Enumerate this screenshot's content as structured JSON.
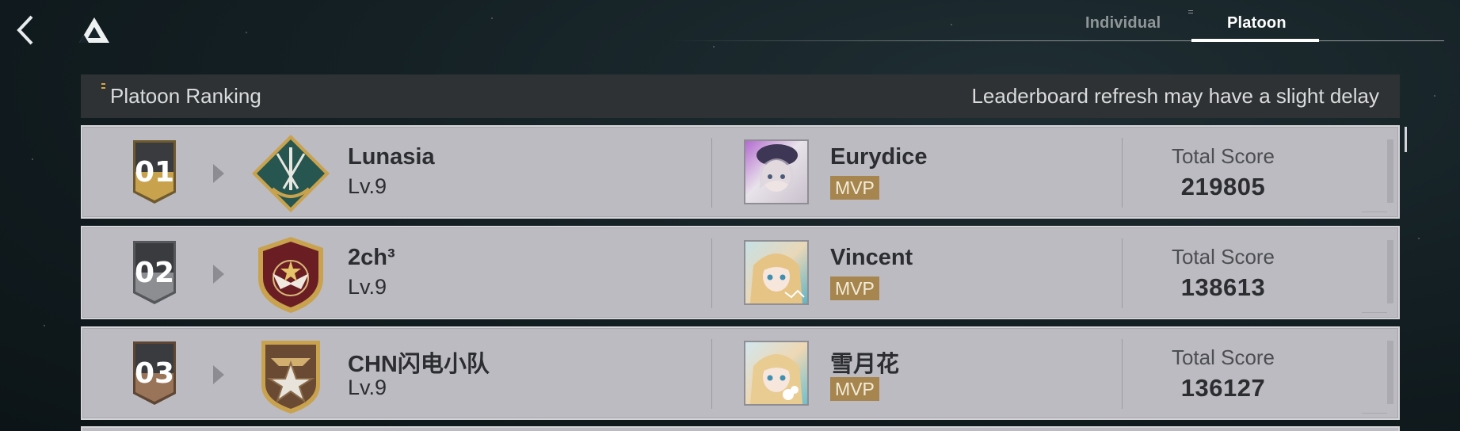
{
  "header": {
    "tabs": [
      {
        "label": "Individual",
        "active": false
      },
      {
        "label": "Platoon",
        "active": true
      }
    ]
  },
  "section": {
    "title": "Platoon Ranking",
    "note": "Leaderboard refresh may have a slight delay"
  },
  "rows": [
    {
      "rank": "01",
      "rank_color": "#c9a24e",
      "platoon_name": "Lunasia",
      "level": "Lv.9",
      "mvp_name": "Eurydice",
      "mvp_badge": "MVP",
      "score_label": "Total Score",
      "score": "219805",
      "emblem": "swords-shield-emblem-icon"
    },
    {
      "rank": "02",
      "rank_color": "#8c8e92",
      "platoon_name": "2ch³",
      "level": "Lv.9",
      "mvp_name": "Vincent",
      "mvp_badge": "MVP",
      "score_label": "Total Score",
      "score": "138613",
      "emblem": "eagle-shield-emblem-icon"
    },
    {
      "rank": "03",
      "rank_color": "#9a7458",
      "platoon_name": "CHN闪电小队",
      "level": "Lv.9",
      "mvp_name": "雪月花",
      "mvp_badge": "MVP",
      "score_label": "Total Score",
      "score": "136127",
      "emblem": "star-wings-emblem-icon"
    }
  ],
  "colors": {
    "accent_gold": "#a6864e",
    "row_bg": "#bcbbc2",
    "header_bg": "#2f3234"
  }
}
